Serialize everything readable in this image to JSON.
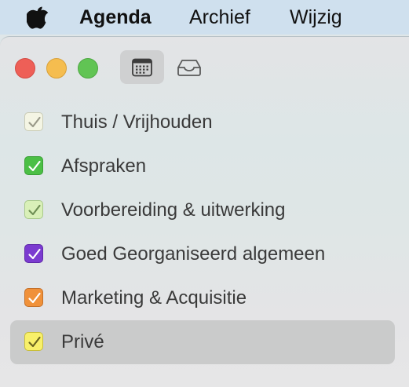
{
  "menubar": {
    "apple_icon": "apple-logo-icon",
    "items": [
      {
        "label": "Agenda",
        "bold": true
      },
      {
        "label": "Archief",
        "bold": false
      },
      {
        "label": "Wijzig",
        "bold": false
      }
    ]
  },
  "window": {
    "traffic_lights": {
      "close_color": "#ee5f57",
      "minimize_color": "#f5bd4f",
      "zoom_color": "#61c454"
    },
    "toolbar": {
      "calendar_icon": "calendar-icon",
      "inbox_icon": "inbox-tray-icon",
      "active": "calendar"
    }
  },
  "calendars": [
    {
      "label": "Thuis / Vrijhouden",
      "checked": true,
      "color": "#f4f5e4",
      "border": "#c9cbb5",
      "check": "#9a9a8a",
      "selected": false
    },
    {
      "label": "Afspraken",
      "checked": true,
      "color": "#4bbf45",
      "border": "#3a9f36",
      "check": "#ffffff",
      "selected": false
    },
    {
      "label": "Voorbereiding & uitwerking",
      "checked": true,
      "color": "#d9f0b8",
      "border": "#a8c98a",
      "check": "#6f8f55",
      "selected": false
    },
    {
      "label": "Goed Georganiseerd algemeen",
      "checked": true,
      "color": "#7b3bd0",
      "border": "#5f2aa8",
      "check": "#ffffff",
      "selected": false
    },
    {
      "label": "Marketing & Acquisitie",
      "checked": true,
      "color": "#f0913a",
      "border": "#c4702a",
      "check": "#ffffff",
      "selected": false
    },
    {
      "label": "Privé",
      "checked": true,
      "color": "#f8f06a",
      "border": "#c9bf3a",
      "check": "#6a6520",
      "selected": true
    }
  ]
}
